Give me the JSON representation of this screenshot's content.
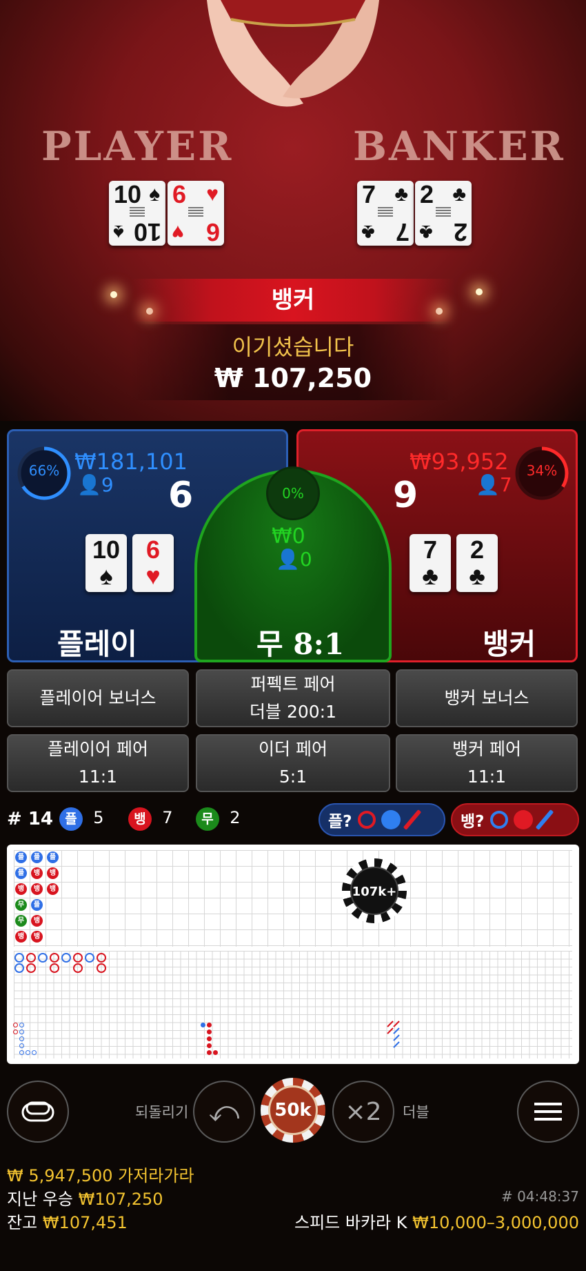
{
  "table": {
    "player_label": "PLAYER",
    "banker_label": "BANKER",
    "player_cards": [
      {
        "rank": "10",
        "suit": "♠",
        "color": "black"
      },
      {
        "rank": "6",
        "suit": "♥",
        "color": "red"
      }
    ],
    "banker_cards": [
      {
        "rank": "7",
        "suit": "♣",
        "color": "black"
      },
      {
        "rank": "2",
        "suit": "♣",
        "color": "black"
      }
    ]
  },
  "result": {
    "banner": "뱅커",
    "win_title": "이기셨습니다",
    "win_amount": "₩ 107,250"
  },
  "player": {
    "percent": "66%",
    "percent_value": 0.66,
    "amount": "₩181,101",
    "players": "9",
    "score": "6",
    "label": "플레이어",
    "color": "#2f8fff"
  },
  "tie": {
    "percent": "0%",
    "amount": "₩0",
    "players": "0",
    "label": "무",
    "payout": "8:1",
    "color": "#22d422"
  },
  "banker": {
    "percent": "34%",
    "percent_value": 0.34,
    "amount": "₩93,952",
    "players": "7",
    "score": "9",
    "label": "뱅커",
    "color": "#ff2a2a"
  },
  "side_bets": {
    "player_bonus": "플레이어 보너스",
    "perfect_pair_1": "퍼펙트 페어",
    "perfect_pair_2": "더블 200:1",
    "banker_bonus": "뱅커 보너스",
    "player_pair_1": "플레이어 페어",
    "player_pair_2": "11:1",
    "either_pair_1": "이더 페어",
    "either_pair_2": "5:1",
    "banker_pair_1": "뱅커 페어",
    "banker_pair_2": "11:1"
  },
  "stats": {
    "round": "# 14",
    "p_icon": "플",
    "p_count": "5",
    "b_icon": "뱅",
    "b_count": "7",
    "t_icon": "무",
    "t_count": "2",
    "p_ask": "플?",
    "b_ask": "뱅?"
  },
  "roads": {
    "chip_label": "107k+",
    "bead_plate": [
      [
        "플",
        "플",
        "뱅",
        "무",
        "무",
        "뱅"
      ],
      [
        "플",
        "뱅",
        "뱅",
        "플",
        "뱅",
        "뱅"
      ],
      [
        "플",
        "뱅",
        "뱅"
      ]
    ]
  },
  "controls": {
    "undo_label": "되돌리기",
    "chip_value": "50k",
    "double_symbol": "×2",
    "double_label": "더블"
  },
  "footer": {
    "jackpot": "₩ 5,947,500 가저라가라",
    "last_win_label": "지난 우승",
    "last_win": "₩107,250",
    "time": "# 04:48:37",
    "balance_label": "잔고",
    "balance": "₩107,451",
    "table_name": "스피드 바카라 K",
    "limits": "₩10,000–3,000,000"
  }
}
